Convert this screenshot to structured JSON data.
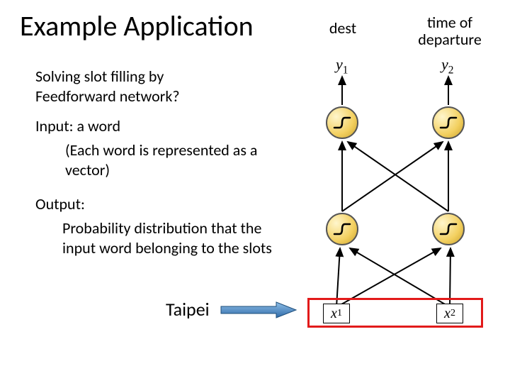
{
  "title": "Example Application",
  "left": {
    "q": "Solving slot filling by Feedforward network?",
    "input_label": "Input: a word",
    "input_desc": "(Each word is represented as a vector)",
    "output_label": "Output:",
    "output_desc": "Probability distribution that the input word belonging to the slots",
    "example_word": "Taipei"
  },
  "diagram": {
    "top_labels": [
      "dest",
      "time of departure"
    ],
    "y": [
      "y",
      "y"
    ],
    "y_sub": [
      "1",
      "2"
    ],
    "x": [
      "x",
      "x"
    ],
    "x_sub": [
      "1",
      "2"
    ]
  }
}
